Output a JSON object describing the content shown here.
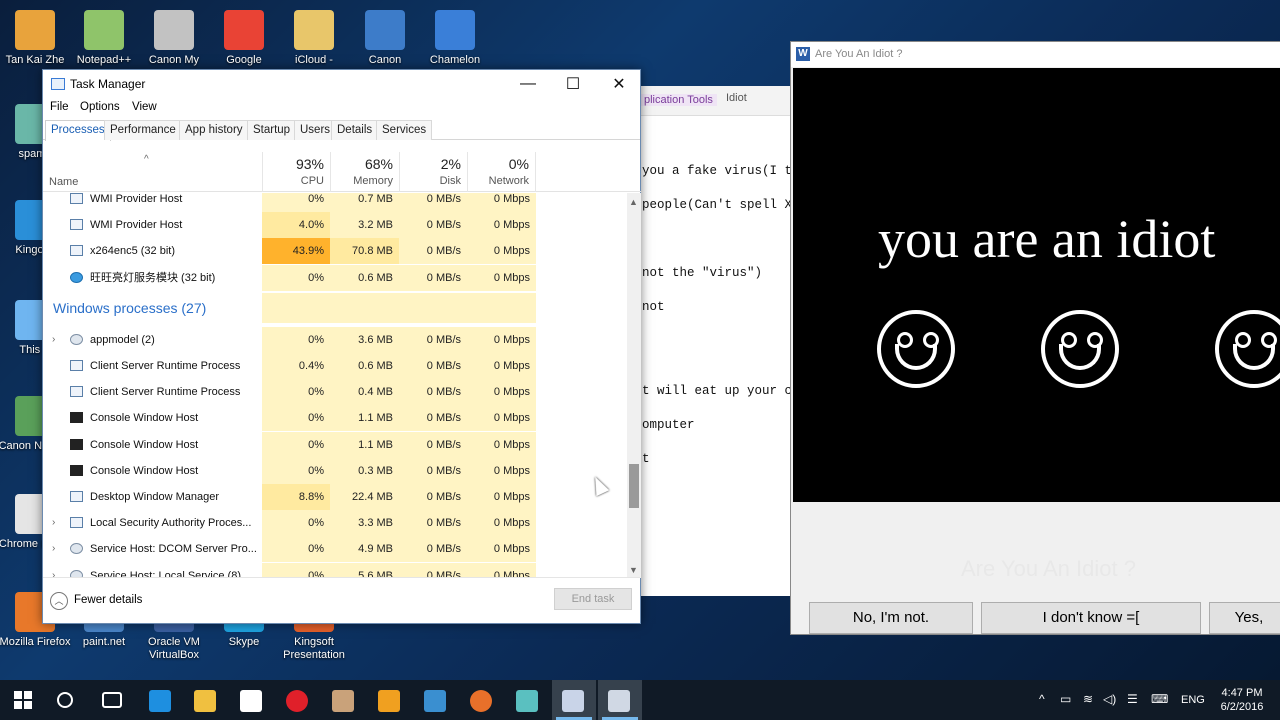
{
  "desktop_icons": [
    {
      "label": "Tan Kai Zhe",
      "icon": "user-folder-icon",
      "color": "#e8a33c"
    },
    {
      "label": "Notepad++",
      "icon": "notepadpp-icon",
      "color": "#8fc46a"
    },
    {
      "label": "Canon My",
      "icon": "canon-my-icon",
      "color": "#c2c2c2"
    },
    {
      "label": "Google",
      "icon": "chrome-icon",
      "color": "#e94335"
    },
    {
      "label": "iCloud -",
      "icon": "icloud-folder-icon",
      "color": "#e8c66a"
    },
    {
      "label": "Canon",
      "icon": "canon-help-icon",
      "color": "#3d7cc9"
    },
    {
      "label": "Chamelon",
      "icon": "chameleon-icon",
      "color": "#3a7fd8"
    },
    {
      "label": "spamb",
      "icon": "spam-icon",
      "color": "#6ab7a8"
    },
    {
      "label": "Kingo R",
      "icon": "kingo-root-icon",
      "color": "#2a8fd8"
    },
    {
      "label": "This P",
      "icon": "computer-icon",
      "color": "#6fb5f0"
    },
    {
      "label": "Canon Navigat",
      "icon": "canon-nav-icon",
      "color": "#5aa05a"
    },
    {
      "label": "Chrome Launc",
      "icon": "chrome-launcher-icon",
      "color": "#e5e5e5"
    },
    {
      "label": "Mozilla Firefox",
      "icon": "firefox-icon",
      "color": "#e8782a"
    },
    {
      "label": "paint.net",
      "icon": "paintnet-icon",
      "color": "#4a86c9"
    },
    {
      "label": "Oracle VM VirtualBox",
      "icon": "virtualbox-icon",
      "color": "#3a5fa0"
    },
    {
      "label": "Skype",
      "icon": "skype-icon",
      "color": "#1ea3e0"
    },
    {
      "label": "Kingsoft Presentation",
      "icon": "kingsoft-icon",
      "color": "#e5602a"
    }
  ],
  "doc_window": {
    "ribbon_tab": "plication Tools",
    "title": "Idiot",
    "lines": [
      "you a fake virus(I t",
      "people(Can't spell X",
      "not the \"virus\")",
      "not",
      "t will eat up your c",
      "omputer",
      "t"
    ]
  },
  "task_manager": {
    "title": "Task Manager",
    "menu": [
      "File",
      "Options",
      "View"
    ],
    "tabs": [
      "Processes",
      "Performance",
      "App history",
      "Startup",
      "Users",
      "Details",
      "Services"
    ],
    "columns": {
      "name": "Name",
      "cpu": {
        "pct": "93%",
        "label": "CPU"
      },
      "memory": {
        "pct": "68%",
        "label": "Memory"
      },
      "disk": {
        "pct": "2%",
        "label": "Disk"
      },
      "network": {
        "pct": "0%",
        "label": "Network"
      }
    },
    "top_rows": [
      {
        "name": "WMI Provider Host",
        "cpu": "0%",
        "mem": "0.7 MB",
        "disk": "0 MB/s",
        "net": "0 Mbps",
        "icon": "wmi-icon"
      },
      {
        "name": "WMI Provider Host",
        "cpu": "4.0%",
        "mem": "3.2 MB",
        "disk": "0 MB/s",
        "net": "0 Mbps",
        "icon": "wmi-icon"
      },
      {
        "name": "x264enc5 (32 bit)",
        "cpu": "43.9%",
        "mem": "70.8 MB",
        "disk": "0 MB/s",
        "net": "0 Mbps",
        "icon": "app-icon"
      },
      {
        "name": "旺旺亮灯服务模块 (32 bit)",
        "cpu": "0%",
        "mem": "0.6 MB",
        "disk": "0 MB/s",
        "net": "0 Mbps",
        "icon": "wangwang-icon"
      }
    ],
    "section_title": "Windows processes (27)",
    "win_rows": [
      {
        "name": "appmodel (2)",
        "cpu": "0%",
        "mem": "3.6 MB",
        "disk": "0 MB/s",
        "net": "0 Mbps",
        "icon": "gear-icon",
        "expand": true
      },
      {
        "name": "Client Server Runtime Process",
        "cpu": "0.4%",
        "mem": "0.6 MB",
        "disk": "0 MB/s",
        "net": "0 Mbps",
        "icon": "app-icon",
        "expand": false
      },
      {
        "name": "Client Server Runtime Process",
        "cpu": "0%",
        "mem": "0.4 MB",
        "disk": "0 MB/s",
        "net": "0 Mbps",
        "icon": "app-icon",
        "expand": false
      },
      {
        "name": "Console Window Host",
        "cpu": "0%",
        "mem": "1.1 MB",
        "disk": "0 MB/s",
        "net": "0 Mbps",
        "icon": "console-icon",
        "expand": false
      },
      {
        "name": "Console Window Host",
        "cpu": "0%",
        "mem": "1.1 MB",
        "disk": "0 MB/s",
        "net": "0 Mbps",
        "icon": "console-icon",
        "expand": false
      },
      {
        "name": "Console Window Host",
        "cpu": "0%",
        "mem": "0.3 MB",
        "disk": "0 MB/s",
        "net": "0 Mbps",
        "icon": "console-icon",
        "expand": false
      },
      {
        "name": "Desktop Window Manager",
        "cpu": "8.8%",
        "mem": "22.4 MB",
        "disk": "0 MB/s",
        "net": "0 Mbps",
        "icon": "app-icon",
        "expand": false
      },
      {
        "name": "Local Security Authority Proces...",
        "cpu": "0%",
        "mem": "3.3 MB",
        "disk": "0 MB/s",
        "net": "0 Mbps",
        "icon": "app-icon",
        "expand": true
      },
      {
        "name": "Service Host: DCOM Server Pro...",
        "cpu": "0%",
        "mem": "4.9 MB",
        "disk": "0 MB/s",
        "net": "0 Mbps",
        "icon": "gear-icon",
        "expand": true
      },
      {
        "name": "Service Host: Local Service (8)",
        "cpu": "0%",
        "mem": "5.6 MB",
        "disk": "0 MB/s",
        "net": "0 Mbps",
        "icon": "gear-icon",
        "expand": true
      }
    ],
    "fewer_details": "Fewer details",
    "end_task": "End task"
  },
  "idiot_window": {
    "title": "Are You An Idiot ?",
    "headline": "you are an idiot",
    "faded_text": "Are You An Idiot ?",
    "buttons": [
      "No, I'm not.",
      "I don't know =[",
      "Yes,"
    ]
  },
  "taskbar": {
    "language": "ENG",
    "time": "4:47 PM",
    "date": "6/2/2016"
  },
  "colors": {
    "cpu_heat_high": "#ffb22c",
    "cpu_heat_mid": "#ffeaa0",
    "cpu_heat_low": "#fff4c4",
    "accent_blue": "#2a6fc9"
  }
}
